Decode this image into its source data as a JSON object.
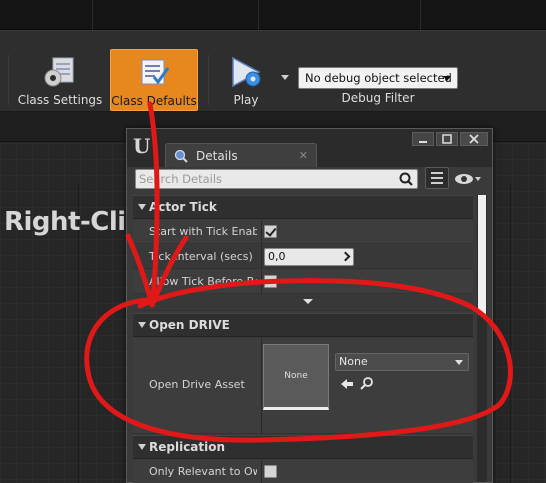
{
  "toolbar": {
    "class_settings_label": "Class Settings",
    "class_defaults_label": "Class Defaults",
    "play_label": "Play",
    "debug_select_value": "No debug object selected",
    "debug_filter_label": "Debug Filter"
  },
  "graph": {
    "hint_text": "Right-Clic"
  },
  "details": {
    "tab_label": "Details",
    "search_placeholder": "Search Details",
    "actor_tick": {
      "header": "Actor Tick",
      "start_with_tick_label": "Start with Tick Enabl",
      "start_with_tick_checked": true,
      "tick_interval_label": "Tick Interval (secs)",
      "tick_interval_value": "0,0",
      "allow_tick_label": "Allow Tick Before Be",
      "allow_tick_checked": false
    },
    "open_drive": {
      "header": "Open DRIVE",
      "asset_label": "Open Drive Asset",
      "thumbnail_text": "None",
      "combo_value": "None"
    },
    "replication": {
      "header": "Replication",
      "only_relevant_label": "Only Relevant to Ow"
    }
  },
  "colors": {
    "accent_orange": "#e8871e",
    "annotation_red": "#e01818"
  },
  "icons": [
    "class-settings-icon",
    "class-defaults-icon",
    "play-icon",
    "unreal-logo-icon",
    "details-icon",
    "search-icon",
    "view-options-icon",
    "eye-icon",
    "use-selected-icon",
    "browse-icon"
  ]
}
